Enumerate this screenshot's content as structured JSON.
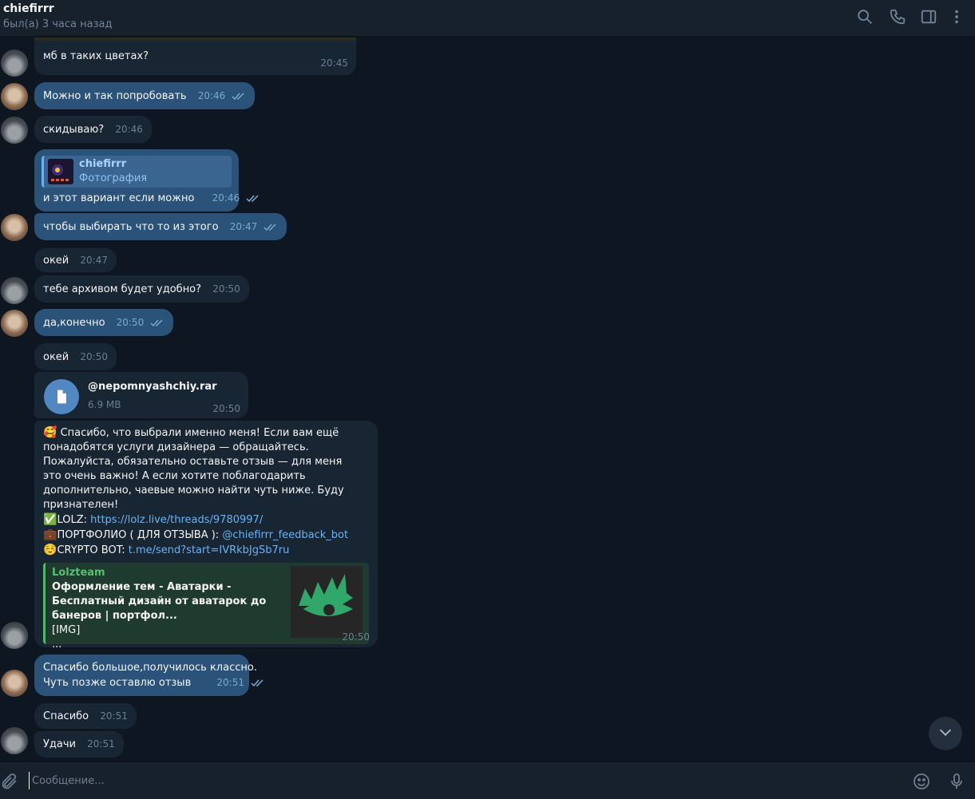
{
  "header": {
    "name": "chiefirrr",
    "status": "был(а) 3 часа назад"
  },
  "messages": {
    "m1": {
      "text": "мб в таких цветах?",
      "time": "20:45"
    },
    "m2": {
      "text": "Можно и так попробовать",
      "time": "20:46"
    },
    "m3": {
      "text": "скидываю?",
      "time": "20:46"
    },
    "m4": {
      "reply_name": "chiefirrr",
      "reply_text": "Фотография",
      "text": "и этот вариант если можно",
      "time": "20:46"
    },
    "m5": {
      "text": "чтобы выбирать что то из этого",
      "time": "20:47"
    },
    "m6": {
      "text": "окей",
      "time": "20:47"
    },
    "m7": {
      "text": "тебе архивом будет удобно?",
      "time": "20:50"
    },
    "m8": {
      "text": "да,конечно",
      "time": "20:50"
    },
    "m9": {
      "text": "окей",
      "time": "20:50"
    },
    "m10": {
      "file_name": "@nepomnyashchiy.rar",
      "file_size": "6.9 MB",
      "time": "20:50"
    },
    "m11": {
      "emoji1": "🥰",
      "text": "Спасибо, что выбрали именно меня! Если вам ещё понадобятся услуги дизайнера — обращайтесь. Пожалуйста, обязательно оставьте отзыв — для меня это очень важно! А если хотите поблагодарить дополнительно, чаевые можно найти чуть ниже. Буду признателен!",
      "emoji2": "✅",
      "lolz_label": "LOLZ: ",
      "lolz_link": "https://lolz.live/threads/9780997/",
      "emoji3": "💼",
      "portfolio_label": "ПОРТФОЛИО ( ДЛЯ ОТЗЫВА ): ",
      "portfolio_link": "@chiefirrr_feedback_bot",
      "emoji4": "☺️",
      "crypto_label": "CRYPTO BOT: ",
      "crypto_link": "t.me/send?start=IVRkbJgSb7ru",
      "preview_site": "Lolzteam",
      "preview_title": "Оформление тем - Аватарки - Бесплатный дизайн от аватарок до банеров | портфол...",
      "preview_line1": "[IMG]",
      "preview_line2": "...",
      "time": "20:50"
    },
    "m12": {
      "line1": "Спасибо большое,получилось классно.",
      "line2": "Чуть позже оставлю отзыв",
      "time": "20:51"
    },
    "m13": {
      "text": "Спасибо",
      "time": "20:51"
    },
    "m14": {
      "text": "Удачи",
      "time": "20:51"
    }
  },
  "composer": {
    "placeholder": "Сообщение..."
  },
  "colors": {
    "background": "#0e1621",
    "header": "#17212b",
    "incoming": "#182533",
    "outgoing": "#2b5278",
    "accent": "#6ab3f3",
    "preview_accent": "#4fb86a"
  },
  "icons": [
    "search-icon",
    "phone-icon",
    "sidebar-icon",
    "more-icon",
    "check-double-icon",
    "file-icon",
    "chevron-down-icon",
    "attach-icon",
    "emoji-icon",
    "mic-icon"
  ]
}
